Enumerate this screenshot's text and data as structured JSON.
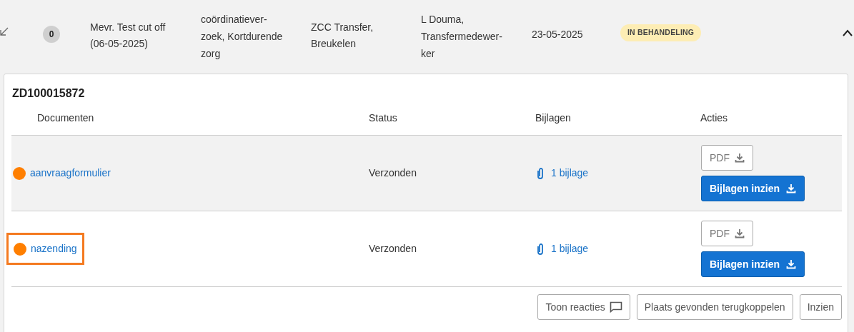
{
  "case_row": {
    "count": "0",
    "client": [
      "Mevr. Test cut off",
      "(06-05-2025)"
    ],
    "type": [
      "coördinatiever-",
      "zoek, Kortdurende",
      "zorg"
    ],
    "location": [
      "ZCC Transfer,",
      "Breukelen"
    ],
    "person": [
      "L Douma,",
      "Transfermedewer-",
      "ker"
    ],
    "date": "23-05-2025",
    "status": "IN BEHANDELING",
    "expanded": true
  },
  "detail": {
    "title": "ZD100015872",
    "columns": [
      "Documenten",
      "Status",
      "Bijlagen",
      "Acties"
    ],
    "rows": [
      {
        "name": "aanvraagformulier",
        "color": "#ff7f00",
        "status": "Verzonden",
        "attachments": "1 bijlage",
        "pdf": "PDF",
        "view": "Bijlagen inzien",
        "selected": true,
        "highlighted": false
      },
      {
        "name": "nazending",
        "color": "#ff7f00",
        "status": "Verzonden",
        "attachments": "1 bijlage",
        "pdf": "PDF",
        "view": "Bijlagen inzien",
        "selected": false,
        "highlighted": true
      }
    ],
    "buttons": [
      {
        "label": "Toon reacties",
        "kind": "comment"
      },
      {
        "label": "Plaats gevonden terugkoppelen",
        "kind": "plain"
      },
      {
        "label": "Inzien",
        "kind": "plain"
      }
    ]
  }
}
